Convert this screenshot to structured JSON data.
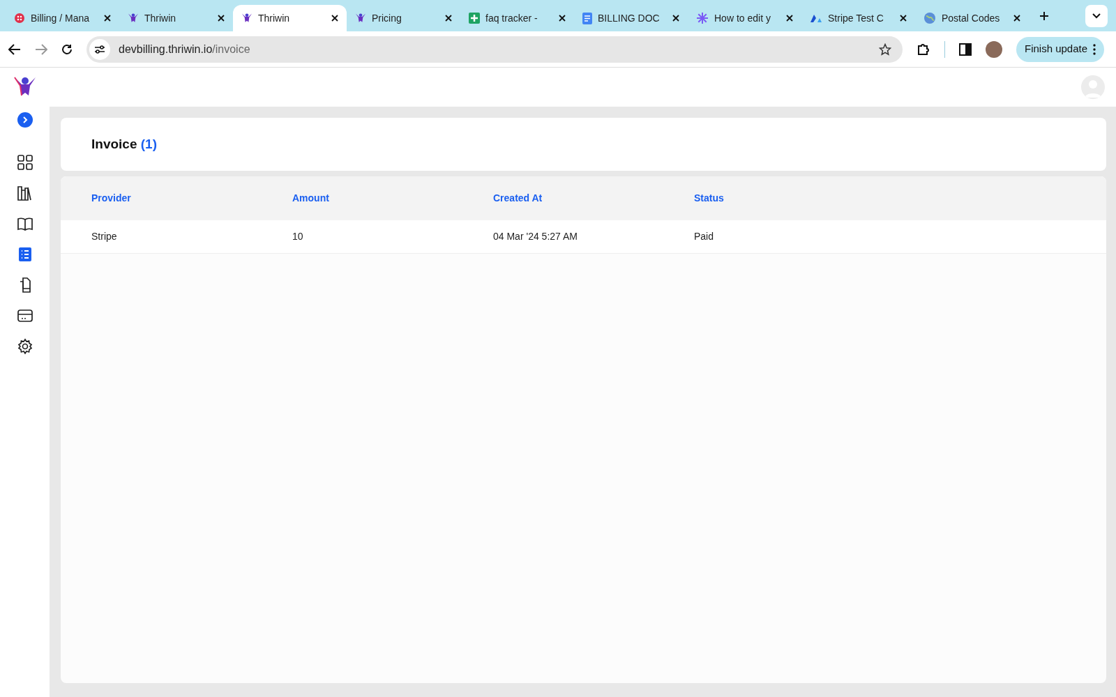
{
  "browser": {
    "tabs": [
      {
        "title": "Billing / Mana",
        "selected": false
      },
      {
        "title": "Thriwin",
        "selected": false
      },
      {
        "title": "Thriwin",
        "selected": true
      },
      {
        "title": "Pricing",
        "selected": false
      },
      {
        "title": "faq tracker -",
        "selected": false
      },
      {
        "title": "BILLING DOC",
        "selected": false
      },
      {
        "title": "How to edit y",
        "selected": false
      },
      {
        "title": "Stripe Test C",
        "selected": false
      },
      {
        "title": "Postal Codes",
        "selected": false
      }
    ],
    "url_host": "devbilling.thriwin.io",
    "url_path": "/invoice",
    "update_button": "Finish update"
  },
  "sidebar": {
    "items": [
      {
        "selected": false
      },
      {
        "selected": false
      },
      {
        "selected": false
      },
      {
        "selected": true
      },
      {
        "selected": false
      },
      {
        "selected": false
      },
      {
        "selected": false
      }
    ]
  },
  "page": {
    "title": "Invoice",
    "count": "(1)"
  },
  "table": {
    "columns": [
      "Provider",
      "Amount",
      "Created At",
      "Status"
    ],
    "rows": [
      [
        "Stripe",
        "10",
        "04 Mar '24 5:27 AM",
        "Paid"
      ]
    ]
  }
}
